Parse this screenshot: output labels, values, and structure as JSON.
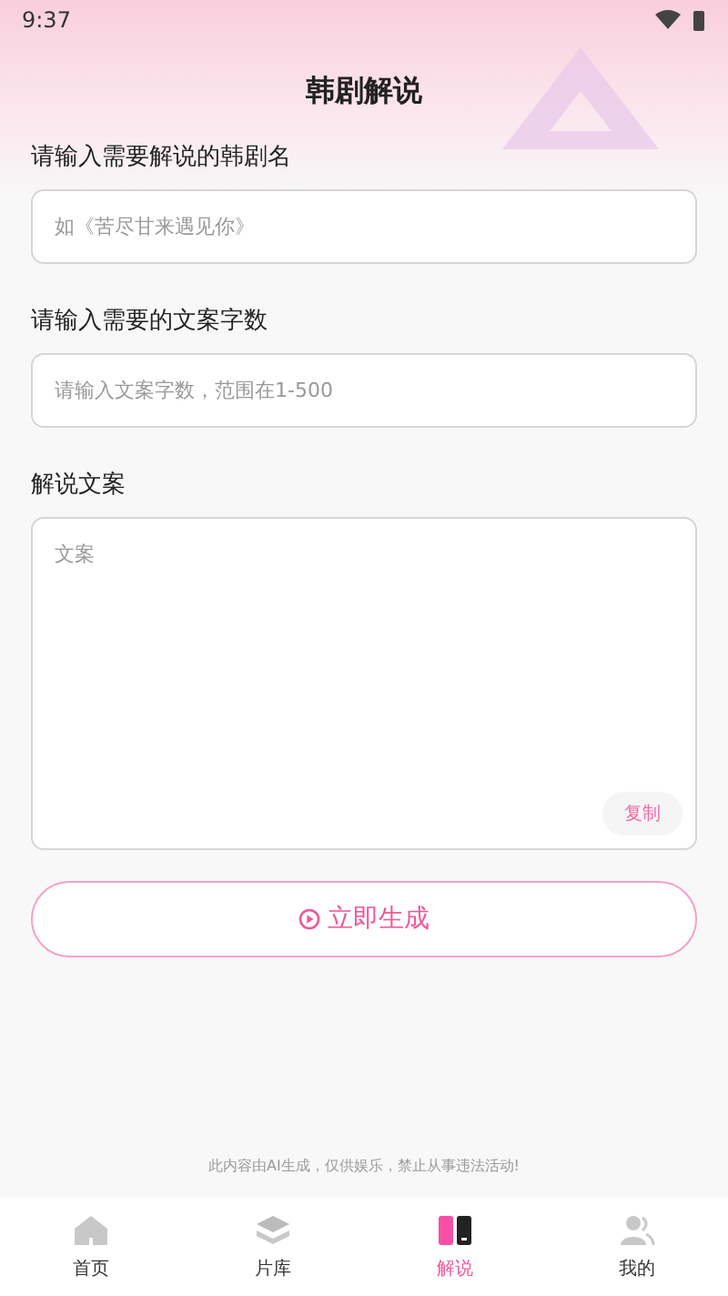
{
  "status_bar": {
    "time": "9:37"
  },
  "title": "韩剧解说",
  "fields": [
    {
      "kind": "input",
      "label": "请输入需要解说的韩剧名",
      "placeholder": "如《苦尽甘来遇见你》"
    },
    {
      "kind": "input",
      "label": "请输入需要的文案字数",
      "placeholder": "请输入文案字数，范围在1-500"
    },
    {
      "kind": "textarea",
      "label": "解说文案",
      "placeholder": "文案",
      "action": "复制"
    }
  ],
  "generate_button": "立即生成",
  "disclaimer": "此内容由AI生成，仅供娱乐，禁止从事违法活动!",
  "tabs": [
    {
      "kind": "home",
      "label": "首页",
      "selected": false
    },
    {
      "kind": "library",
      "label": "片库",
      "selected": false
    },
    {
      "kind": "narrate",
      "label": "解说",
      "selected": true
    },
    {
      "kind": "profile",
      "label": "我的",
      "selected": false
    }
  ]
}
